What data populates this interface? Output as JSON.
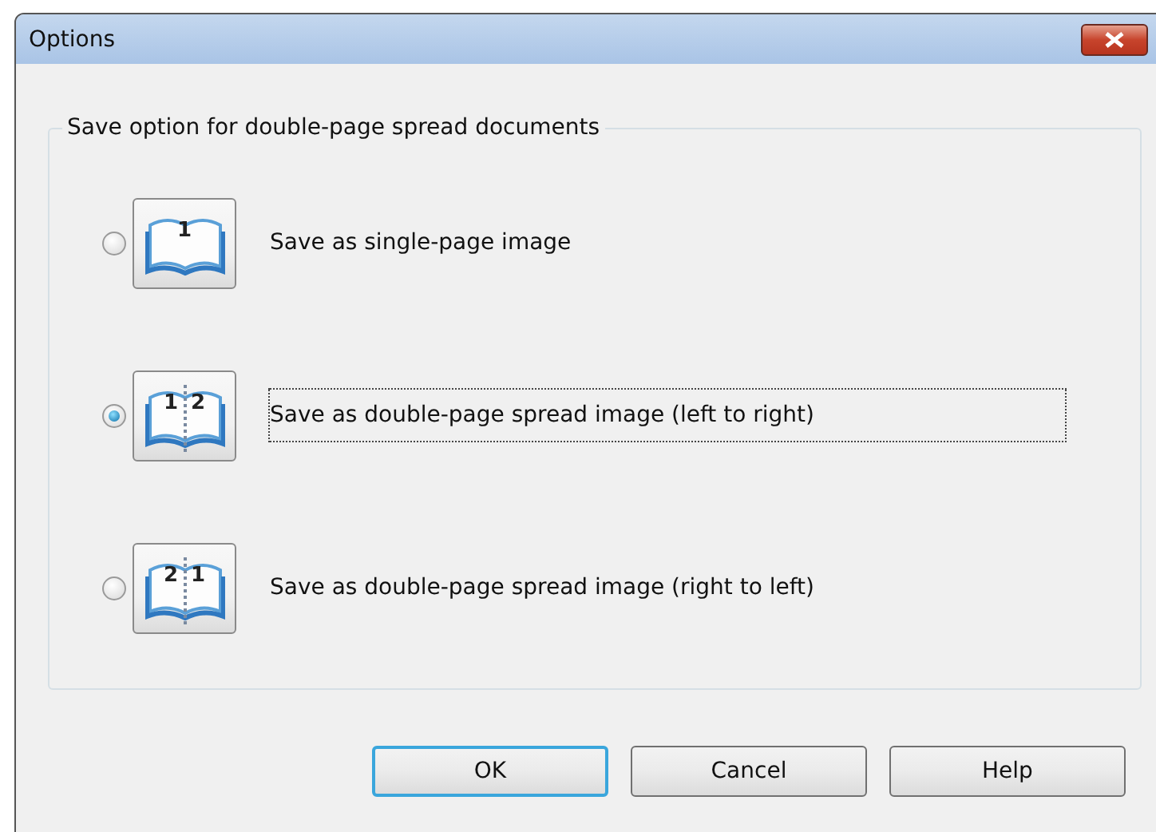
{
  "window": {
    "title": "Options"
  },
  "group": {
    "title": "Save option for double-page spread documents",
    "options": [
      {
        "label": "Save as single-page image",
        "pages": [
          "1"
        ],
        "selected": false
      },
      {
        "label": "Save as double-page spread image (left to right)",
        "pages": [
          "1",
          "2"
        ],
        "selected": true
      },
      {
        "label": "Save as double-page spread image (right to left)",
        "pages": [
          "2",
          "1"
        ],
        "selected": false
      }
    ]
  },
  "buttons": [
    {
      "label": "OK",
      "default": true
    },
    {
      "label": "Cancel",
      "default": false
    },
    {
      "label": "Help",
      "default": false
    }
  ]
}
